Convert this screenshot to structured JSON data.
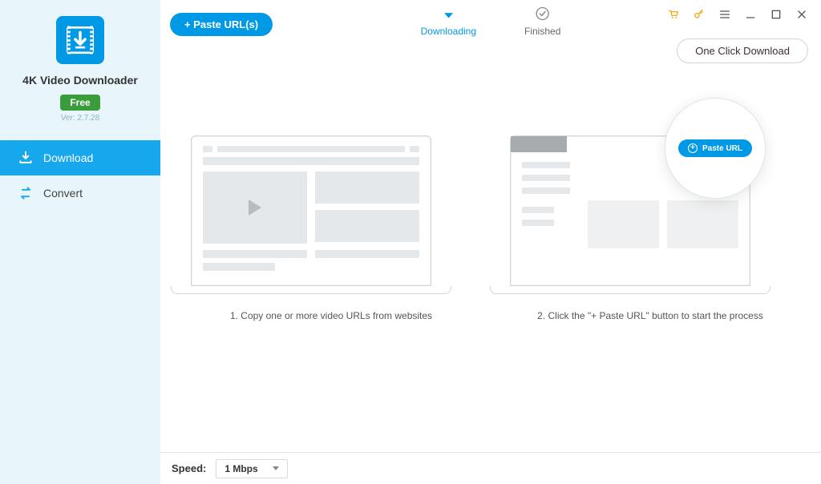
{
  "sidebar": {
    "app_name": "4K Video Downloader",
    "badge": "Free",
    "version": "Ver: 2.7.28",
    "items": [
      {
        "label": "Download",
        "icon": "download-tray-icon",
        "active": true
      },
      {
        "label": "Convert",
        "icon": "convert-arrows-icon",
        "active": false
      }
    ]
  },
  "topbar": {
    "paste_button": "+ Paste URL(s)",
    "tabs": [
      {
        "label": "Downloading",
        "icon": "download-arrow-icon",
        "active": true
      },
      {
        "label": "Finished",
        "icon": "check-circle-icon",
        "active": false
      }
    ],
    "one_click": "One Click Download",
    "title_icons": [
      "cart-icon",
      "key-icon",
      "menu-icon",
      "minimize-icon",
      "maximize-icon",
      "close-icon"
    ]
  },
  "guide": {
    "step1_caption": "1. Copy one or more video URLs from websites",
    "step2_caption": "2. Click the \"+ Paste URL\" button to start the process",
    "lens_button": "Paste URL"
  },
  "statusbar": {
    "speed_label": "Speed:",
    "speed_value": "1 Mbps"
  },
  "colors": {
    "accent": "#0099e5",
    "sidebar_bg": "#e8f6fc",
    "badge_green": "#3a9c3a",
    "title_accent": "#f2a100"
  }
}
